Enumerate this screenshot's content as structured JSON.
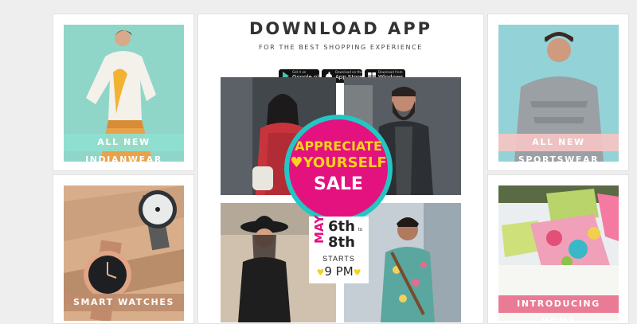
{
  "download": {
    "title": "DOWNLOAD APP",
    "subtitle": "FOR THE BEST SHOPPING EXPERIENCE",
    "badges": [
      {
        "small": "Get it on",
        "big": "Google play"
      },
      {
        "small": "Download on the",
        "big": "App Store"
      },
      {
        "small": "Download from",
        "big": "Windows Store"
      }
    ]
  },
  "promo": {
    "line1": "APPRECIATE",
    "line2": "YOURSELF",
    "line3": "SALE",
    "month": "MAY",
    "date1": "6th",
    "to": "to",
    "date2": "8th",
    "starts": "STARTS",
    "time": "9 PM"
  },
  "tiles": {
    "indianwear": "ALL NEW INDIANWEAR",
    "sportswear": "ALL NEW SPORTSWEAR",
    "watches": "SMART WATCHES",
    "home": "INTRODUCING HOME"
  },
  "colors": {
    "promo_pink": "#e3127f",
    "promo_yellow": "#f8d21c",
    "indian_label": "#8fe0d0",
    "sports_label": "#f5c4c4",
    "watches_label": "#c89a78",
    "home_label": "#e9748e"
  }
}
